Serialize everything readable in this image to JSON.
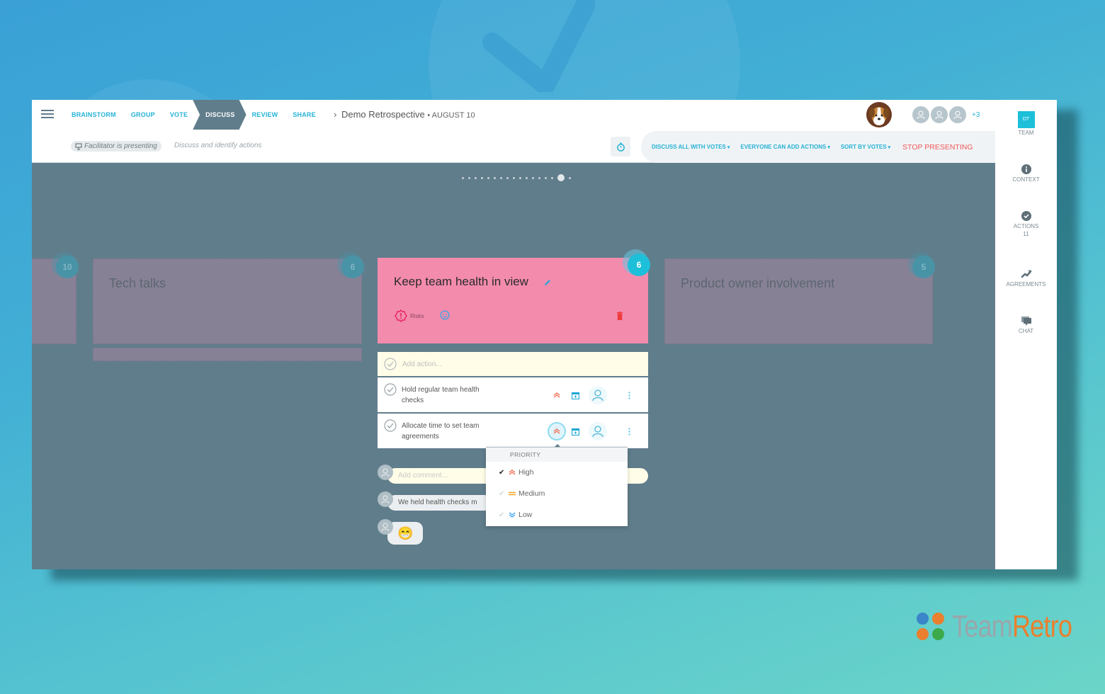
{
  "header": {
    "steps": [
      {
        "label": "BRAINSTORM",
        "active": false
      },
      {
        "label": "GROUP",
        "active": false
      },
      {
        "label": "VOTE",
        "active": false
      },
      {
        "label": "DISCUSS",
        "active": true
      },
      {
        "label": "REVIEW",
        "active": false
      },
      {
        "label": "SHARE",
        "active": false
      }
    ],
    "retro_separator": "›",
    "retro_title": "Demo Retrospective",
    "retro_date": "• AUGUST 10",
    "presenting_badge": "Facilitator is presenting",
    "phase_hint": "Discuss and identify actions",
    "controls": {
      "discuss_mode": "DISCUSS ALL WITH VOTES",
      "action_mode": "EVERYONE CAN ADD ACTIONS",
      "sort_mode": "SORT BY VOTES",
      "stop_presenting": "STOP PRESENTING"
    },
    "participants_more": "+3"
  },
  "sidebar": {
    "team_initials": "DT",
    "items": [
      {
        "label": "TEAM",
        "icon": "team-icon"
      },
      {
        "label": "CONTEXT",
        "icon": "info-icon"
      },
      {
        "label": "ACTIONS",
        "icon": "check-circle-icon",
        "count": "11"
      },
      {
        "label": "AGREEMENTS",
        "icon": "handshake-icon"
      },
      {
        "label": "CHAT",
        "icon": "chat-icon"
      }
    ]
  },
  "carousel": {
    "total": 17,
    "active_index": 15
  },
  "cards": {
    "left_partial": {
      "votes": "10"
    },
    "prev": {
      "title": "Tech talks",
      "votes": "6"
    },
    "current": {
      "title": "Keep team health in view",
      "votes": "6",
      "tag": "Risks",
      "color": "#f38bad"
    },
    "next": {
      "title": "Product owner involvement",
      "votes": "5"
    }
  },
  "actions": {
    "add_placeholder": "Add action...",
    "items": [
      {
        "text": "Hold regular team health checks",
        "priority": "High"
      },
      {
        "text": "Allocate time to set team agreements",
        "priority": "High"
      }
    ]
  },
  "priority_menu": {
    "header": "PRIORITY",
    "options": [
      {
        "label": "High",
        "selected": true,
        "color": "#f26b4f"
      },
      {
        "label": "Medium",
        "selected": false,
        "color": "#f6a623"
      },
      {
        "label": "Low",
        "selected": false,
        "color": "#42a5f5"
      }
    ]
  },
  "comments": {
    "add_placeholder": "Add comment...",
    "items": [
      {
        "text": "We held health checks m"
      },
      {
        "text": "😁"
      }
    ]
  },
  "brand": {
    "word_a": "Team",
    "word_b": "Retro"
  }
}
